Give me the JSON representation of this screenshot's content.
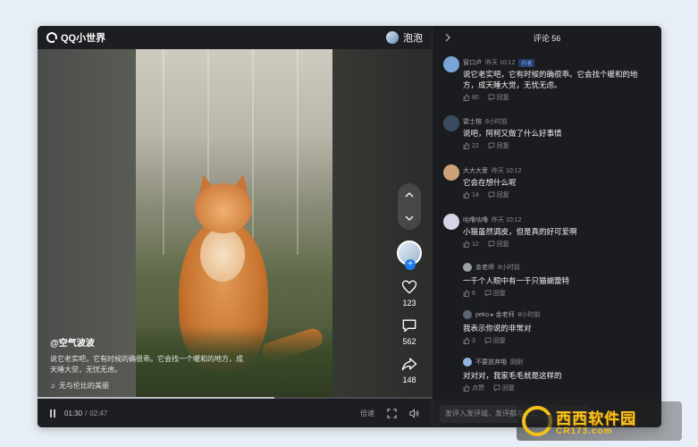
{
  "app": {
    "logo_text": "QQ小世界",
    "user_name": "泡泡"
  },
  "video": {
    "author": "@空气波波",
    "description": "说它老实吧，它有时候的确很乖。它会找一个暖和的地方，成天睡大觉，无忧无虑。",
    "music": "无与伦比的美丽",
    "likes": "123",
    "comments": "562",
    "shares": "148",
    "progress": 0.6,
    "time_current": "01:30",
    "time_total": "02:47",
    "speed_label": "倍速"
  },
  "comments_panel": {
    "title": "评论 56",
    "input_placeholder": "发评入发评城，发评都差……",
    "items": [
      {
        "name": "窗口卢",
        "time": "昨天 10:12",
        "tag": "作者",
        "text": "说它老实吧，它有时候的确很乖。它会找个暖和的地方，成天睡大觉，无忧无虑。",
        "likes": "80",
        "reply": "回复",
        "avatar_color": "#7aa5d6"
      },
      {
        "name": "雷士榕",
        "time": "8小时前",
        "tag": "",
        "text": "说吧，阿柯又做了什么好事情",
        "likes": "22",
        "reply": "回复",
        "avatar_color": "#3b4b5f"
      },
      {
        "name": "大大大爱",
        "time": "昨天 10:12",
        "tag": "",
        "text": "它会在想什么呢",
        "likes": "14",
        "reply": "回复",
        "avatar_color": "#c9a27a"
      },
      {
        "name": "咕噜咕噜",
        "time": "昨天 10:12",
        "tag": "",
        "text": "小猫虽然调皮，但是真的好可爱啊",
        "likes": "12",
        "reply": "回复",
        "avatar_color": "#d9d4e8"
      },
      {
        "name": "金老师",
        "time": "8小时前",
        "tag": "",
        "text": "一千个人眼中有一千只猫蝴蕾特",
        "likes": "6",
        "reply": "回复",
        "avatar_color": "#9aa0a8"
      },
      {
        "name": "peko ▸ 金老师",
        "time": "8小时前",
        "tag": "",
        "text": "我表示你说的非常对",
        "likes": "3",
        "reply": "回复",
        "avatar_color": "#5e6670"
      },
      {
        "name": "不要放弃哦",
        "time": "刚刚",
        "tag": "",
        "text": "对对对，我家毛毛就是这样的",
        "likes": "点赞",
        "reply": "回复",
        "avatar_color": "#8fb4e0"
      }
    ]
  },
  "watermark": {
    "title": "西西软件园",
    "url": "CR173.com"
  }
}
